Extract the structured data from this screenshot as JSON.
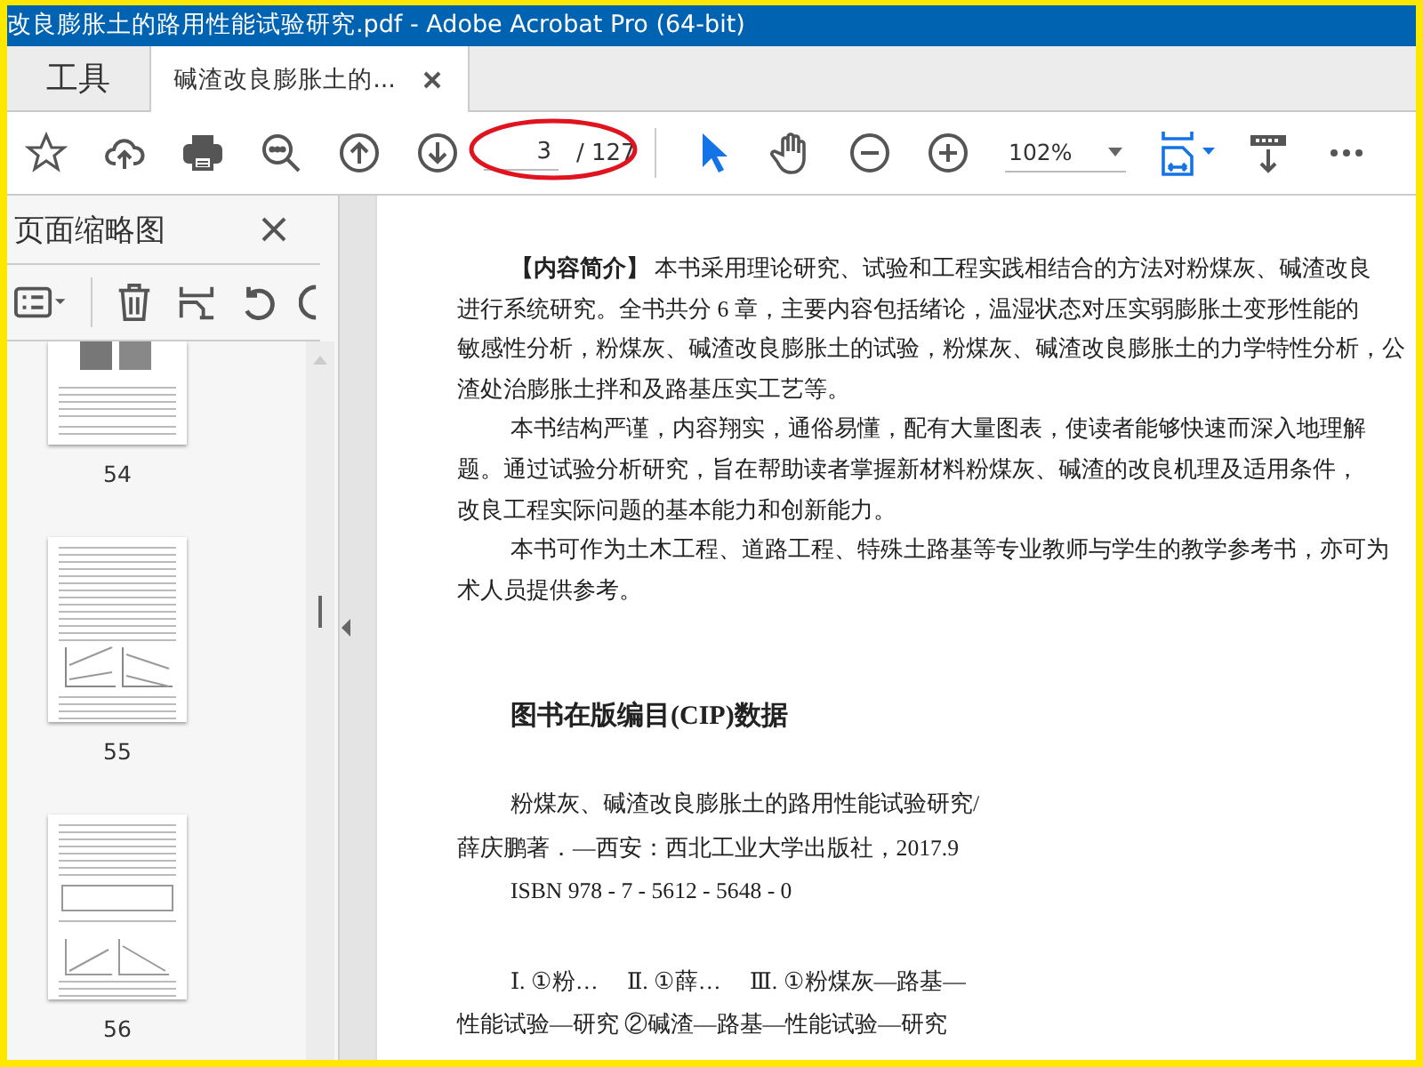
{
  "window": {
    "title": "改良膨胀土的路用性能试验研究.pdf - Adobe Acrobat Pro (64-bit)"
  },
  "tabs": [
    {
      "label": "工具",
      "selected": false,
      "closable": false
    },
    {
      "label": "碱渣改良膨胀土的...",
      "selected": true,
      "closable": true
    }
  ],
  "toolbar": {
    "tools": [
      {
        "kind": "pointer",
        "selected": true
      },
      {
        "kind": "hand",
        "selected": false
      }
    ],
    "page_current": "3",
    "page_total": "/ 127",
    "zoom": "102%",
    "annotation": {
      "kind": "ellipse",
      "color": "#e0141e"
    }
  },
  "sidebar": {
    "title": "页面缩略图",
    "thumbnails": [
      {
        "page": "54",
        "kind": "photos"
      },
      {
        "page": "55",
        "kind": "charts"
      },
      {
        "page": "56",
        "kind": "table"
      }
    ]
  },
  "document": {
    "summary": [
      {
        "lines": [
          "**【内容简介】** 本书采用理论研究、试验和工程实践相结合的方法对粉煤灰、碱渣改良",
          "进行系统研究。全书共分 6 章，主要内容包括绪论，温湿状态对压实弱膨胀土变形性能的",
          "敏感性分析，粉煤灰、碱渣改良膨胀土的试验，粉煤灰、碱渣改良膨胀土的力学特性分析，公",
          "渣处治膨胀土拌和及路基压实工艺等。"
        ]
      },
      {
        "lines": [
          "本书结构严谨，内容翔实，通俗易懂，配有大量图表，使读者能够快速而深入地理解",
          "题。通过试验分析研究，旨在帮助读者掌握新材料粉煤灰、碱渣的改良机理及适用条件，",
          "改良工程实际问题的基本能力和创新能力。"
        ]
      },
      {
        "lines": [
          "本书可作为土木工程、道路工程、特殊土路基等专业教师与学生的教学参考书，亦可为",
          "术人员提供参考。"
        ]
      }
    ],
    "cip_heading": "图书在版编目(CIP)数据",
    "cip": [
      {
        "lines": [
          "粉煤灰、碱渣改良膨胀土的路用性能试验研究/",
          "薛庆鹏著．—西安：西北工业大学出版社，2017.9"
        ]
      },
      {
        "lines": [
          "ISBN 978 - 7 - 5612 - 5648 - 0"
        ]
      },
      {
        "lines": [
          "Ⅰ. ①粉…　 Ⅱ. ①薛…　 Ⅲ. ①粉煤灰—路基—",
          "性能试验—研究 ②碱渣—路基—性能试验—研究"
        ]
      }
    ]
  }
}
